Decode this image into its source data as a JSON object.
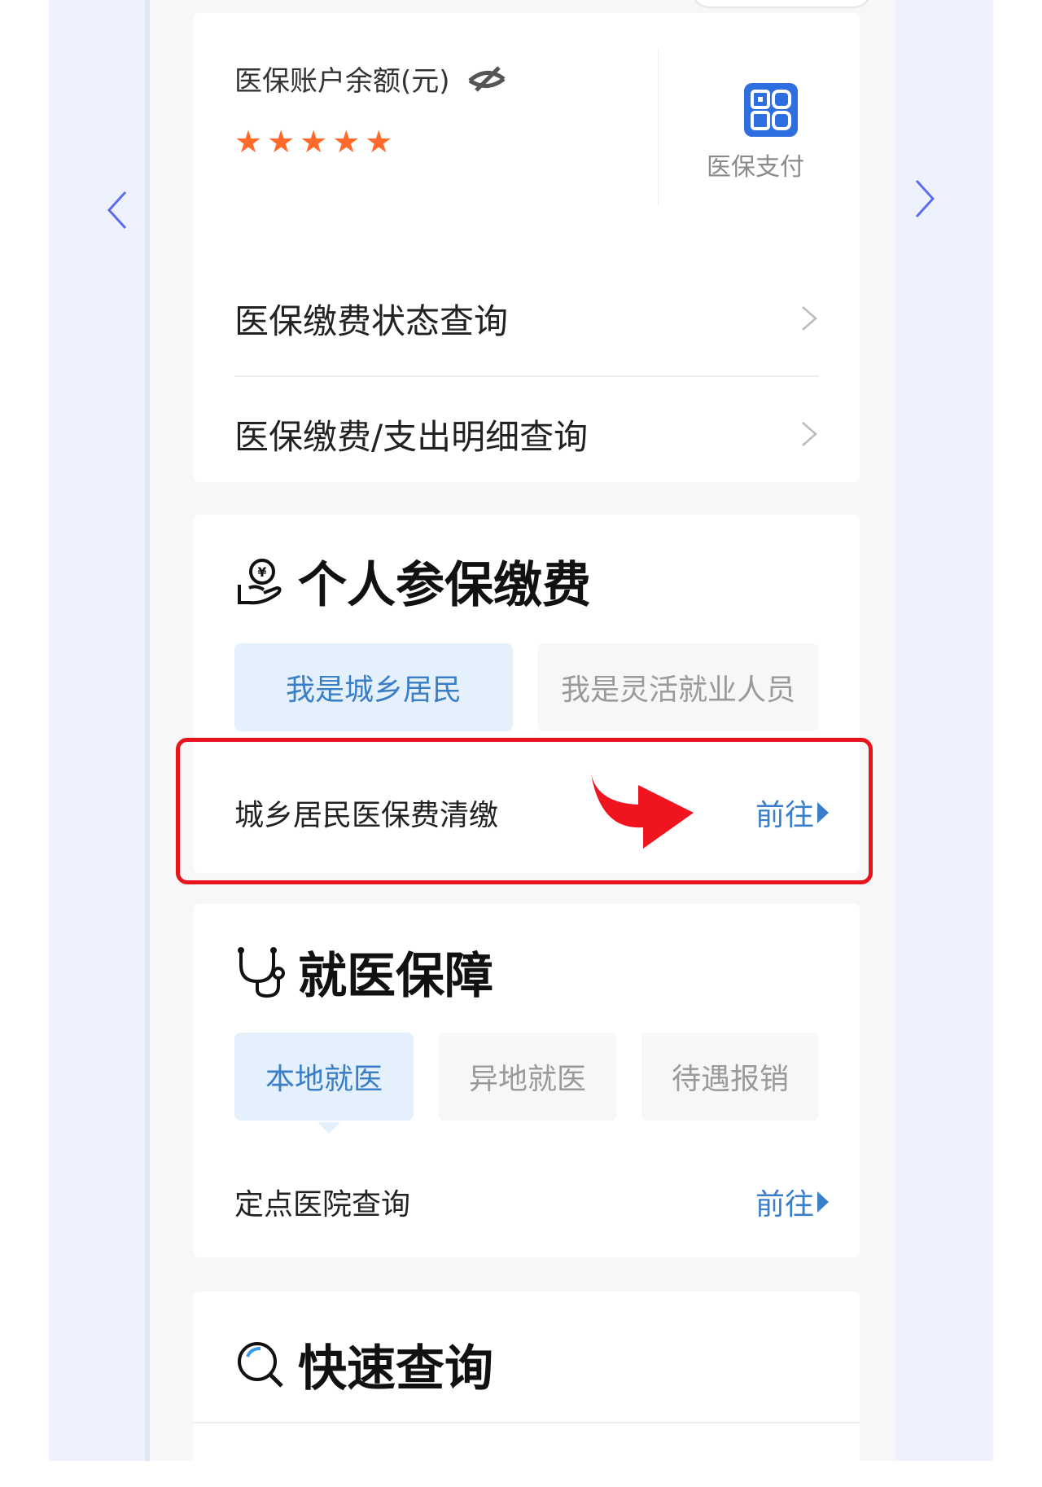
{
  "account": {
    "balance_label": "医保账户余额(元)",
    "balance_masked": "★★★★★",
    "pay_label": "医保支付"
  },
  "menu": [
    {
      "label": "医保缴费状态查询"
    },
    {
      "label": "医保缴费/支出明细查询"
    }
  ],
  "insure": {
    "title": "个人参保缴费",
    "tabs": [
      {
        "label": "我是城乡居民",
        "active": true
      },
      {
        "label": "我是灵活就业人员",
        "active": false
      }
    ],
    "item": {
      "label": "城乡居民医保费清缴",
      "action": "前往"
    }
  },
  "medical": {
    "title": "就医保障",
    "tabs": [
      {
        "label": "本地就医",
        "active": true
      },
      {
        "label": "异地就医",
        "active": false
      },
      {
        "label": "待遇报销",
        "active": false
      }
    ],
    "item": {
      "label": "定点医院查询",
      "action": "前往"
    }
  },
  "query": {
    "title": "快速查询"
  },
  "colors": {
    "accent": "#3b7ec8",
    "star": "#ff6a2b",
    "highlight": "#e8141c",
    "qr": "#2e6fe0"
  }
}
